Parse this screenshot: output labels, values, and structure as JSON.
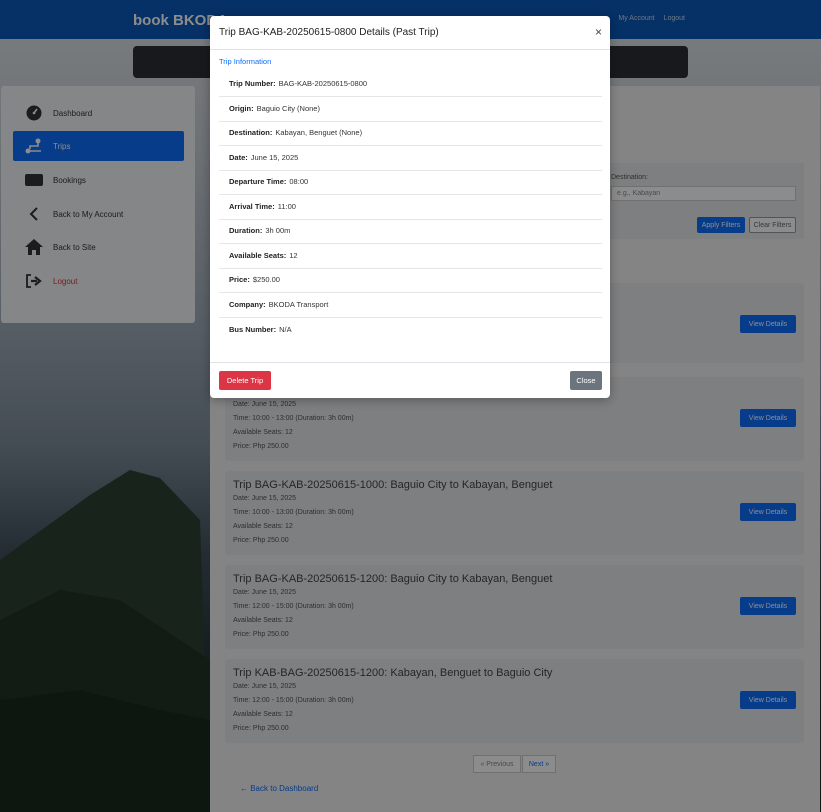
{
  "header": {
    "brand": "book BKODA",
    "nav": [
      "My Account",
      "Logout"
    ]
  },
  "sidebar": {
    "items": [
      {
        "label": "Dashboard",
        "icon": "dashboard-icon"
      },
      {
        "label": "Trips",
        "icon": "route-icon",
        "active": true
      },
      {
        "label": "Bookings",
        "icon": "ticket-icon"
      },
      {
        "label": "Back to My Account",
        "icon": "chevron-left-icon"
      },
      {
        "label": "Back to Site",
        "icon": "home-icon"
      },
      {
        "label": "Logout",
        "icon": "sign-out-icon"
      }
    ]
  },
  "filters": {
    "destination_label": "Destination:",
    "destination_placeholder": "e.g., Kabayan",
    "apply": "Apply Filters",
    "clear": "Clear Filters"
  },
  "trips": [
    {
      "title": "",
      "date": "",
      "time": "",
      "seats": "",
      "price": "",
      "button": "View Details"
    },
    {
      "title": "",
      "date": "Date: June 15, 2025",
      "time": "Time: 10:00 - 13:00 (Duration: 3h 00m)",
      "seats": "Available Seats: 12",
      "price": "Price: Php 250.00",
      "button": "View Details"
    },
    {
      "title": "Trip BAG-KAB-20250615-1000: Baguio City to Kabayan, Benguet",
      "date": "Date: June 15, 2025",
      "time": "Time: 10:00 - 13:00 (Duration: 3h 00m)",
      "seats": "Available Seats: 12",
      "price": "Price: Php 250.00",
      "button": "View Details"
    },
    {
      "title": "Trip BAG-KAB-20250615-1200: Baguio City to Kabayan, Benguet",
      "date": "Date: June 15, 2025",
      "time": "Time: 12:00 - 15:00 (Duration: 3h 00m)",
      "seats": "Available Seats: 12",
      "price": "Price: Php 250.00",
      "button": "View Details"
    },
    {
      "title": "Trip KAB-BAG-20250615-1200: Kabayan, Benguet to Baguio City",
      "date": "Date: June 15, 2025",
      "time": "Time: 12:00 - 15:00 (Duration: 3h 00m)",
      "seats": "Available Seats: 12",
      "price": "Price: Php 250.00",
      "button": "View Details"
    }
  ],
  "pagination": {
    "prev": "« Previous",
    "next": "Next »"
  },
  "back_link": "← Back to Dashboard",
  "modal": {
    "title": "Trip BAG-KAB-20250615-0800 Details (Past Trip)",
    "close_symbol": "×",
    "section": "Trip Information",
    "rows": [
      {
        "label": "Trip Number:",
        "value": "BAG-KAB-20250615-0800"
      },
      {
        "label": "Origin:",
        "value": "Baguio City (None)"
      },
      {
        "label": "Destination:",
        "value": "Kabayan, Benguet (None)"
      },
      {
        "label": "Date:",
        "value": "June 15, 2025"
      },
      {
        "label": "Departure Time:",
        "value": "08:00"
      },
      {
        "label": "Arrival Time:",
        "value": "11:00"
      },
      {
        "label": "Duration:",
        "value": "3h 00m"
      },
      {
        "label": "Available Seats:",
        "value": "12"
      },
      {
        "label": "Price:",
        "value": "$250.00"
      },
      {
        "label": "Company:",
        "value": "BKODA Transport"
      },
      {
        "label": "Bus Number:",
        "value": "N/A"
      }
    ],
    "delete": "Delete Trip",
    "close": "Close"
  },
  "colors": {
    "brand_blue": "#0a5aba",
    "primary": "#0d6efd",
    "danger": "#dc3545",
    "secondary": "#6c757d"
  }
}
